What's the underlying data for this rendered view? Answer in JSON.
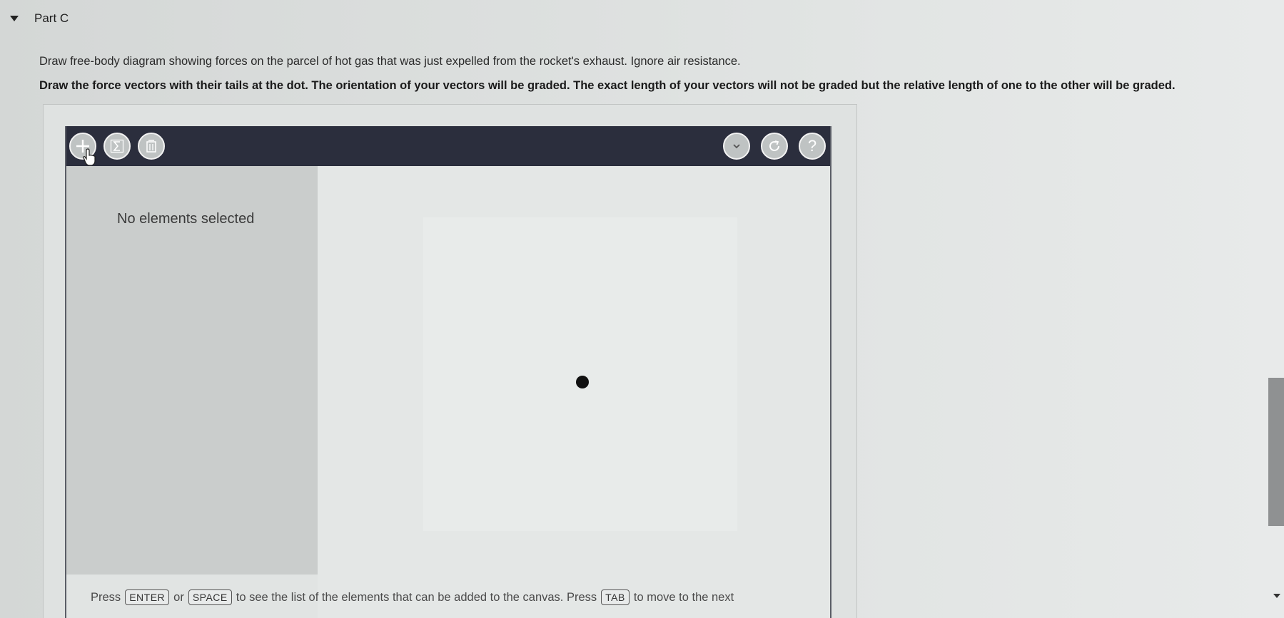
{
  "part": {
    "title": "Part C"
  },
  "question": {
    "instruction": "Draw free-body diagram showing forces on the parcel of hot gas that was just expelled from the rocket's exhaust. Ignore air resistance.",
    "instruction_bold": "Draw the force vectors with their tails at the dot.  The orientation of your vectors will be graded. The exact length of your vectors will not be graded but the relative length of one to the other will be graded."
  },
  "toolbar": {
    "left_buttons": [
      {
        "name": "add-vector-button",
        "icon": "plus-icon"
      },
      {
        "name": "sum-button",
        "icon": "sigma-icon"
      },
      {
        "name": "delete-button",
        "icon": "trash-icon"
      }
    ],
    "right_buttons": [
      {
        "name": "menu-button",
        "icon": "chevron-down-icon"
      },
      {
        "name": "reset-button",
        "icon": "rotate-icon"
      },
      {
        "name": "help-button",
        "icon": "question-icon"
      }
    ]
  },
  "side_panel": {
    "status_text": "No elements selected"
  },
  "hint": {
    "press": "Press",
    "key_enter": "ENTER",
    "or": "or",
    "key_space": "SPACE",
    "middle": "to see the list of the elements that can be added to the canvas. Press",
    "key_tab": "TAB",
    "end": "to move to the next"
  },
  "colors": {
    "toolbar_bg": "#2b2e3d",
    "side_panel_bg": "#cacdcc",
    "canvas_bg": "#e4e7e6",
    "dot": "#111111"
  }
}
